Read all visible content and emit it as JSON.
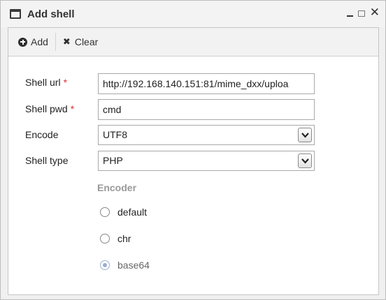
{
  "window": {
    "title": "Add shell",
    "icons": [
      "window-icon",
      "minimize-icon",
      "maximize-icon",
      "close-icon"
    ]
  },
  "toolbar": {
    "add_label": "Add",
    "clear_label": "Clear"
  },
  "form": {
    "shell_url_label": "Shell url",
    "shell_url_value": "http://192.168.140.151:81/mime_dxx/uploa",
    "shell_pwd_label": "Shell pwd",
    "shell_pwd_value": "cmd",
    "required_mark": "*",
    "encode_label": "Encode",
    "encode_value": "UTF8",
    "shell_type_label": "Shell type",
    "shell_type_value": "PHP"
  },
  "encoder": {
    "title": "Encoder",
    "options": [
      {
        "label": "default",
        "checked": false
      },
      {
        "label": "chr",
        "checked": false
      },
      {
        "label": "base64",
        "checked": true
      }
    ]
  },
  "colors": {
    "required": "#e03030",
    "selected_radio": "#9aaed0",
    "section_title": "#999999"
  }
}
